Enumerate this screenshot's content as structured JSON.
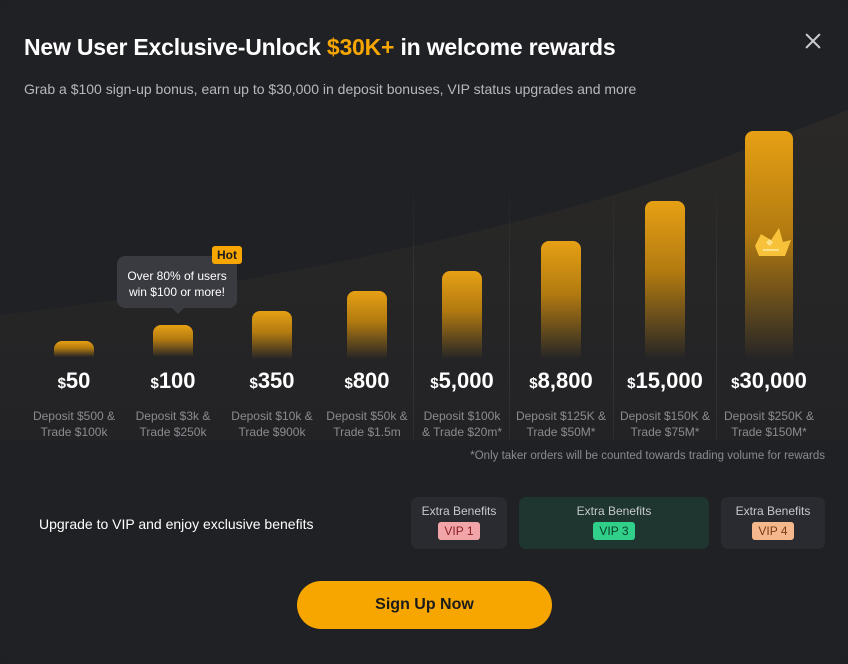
{
  "header": {
    "title_prefix": "New User Exclusive-Unlock ",
    "title_accent": "$30K+",
    "title_suffix": " in welcome rewards",
    "subtitle": "Grab a $100 sign-up bonus, earn up to $30,000 in deposit bonuses, VIP status upgrades and more",
    "close_icon": "close-icon"
  },
  "tiers": [
    {
      "currency": "$",
      "amount": "50",
      "requirement": "Deposit $500 &\nTrade $100k"
    },
    {
      "currency": "$",
      "amount": "100",
      "requirement": "Deposit $3k &\nTrade $250k"
    },
    {
      "currency": "$",
      "amount": "350",
      "requirement": "Deposit $10k &\nTrade $900k"
    },
    {
      "currency": "$",
      "amount": "800",
      "requirement": "Deposit $50k &\nTrade $1.5m"
    },
    {
      "currency": "$",
      "amount": "5,000",
      "requirement": "Deposit $100k\n& Trade $20m*"
    },
    {
      "currency": "$",
      "amount": "8,800",
      "requirement": "Deposit $125K &\nTrade $50M*"
    },
    {
      "currency": "$",
      "amount": "15,000",
      "requirement": "Deposit $150K &\nTrade $75M*"
    },
    {
      "currency": "$",
      "amount": "30,000",
      "requirement": "Deposit $250K &\nTrade $150M*"
    }
  ],
  "tooltip": {
    "text": "Over 80% of users win $100 or more!",
    "line1": "Over 80% of users",
    "line2": "win $100 or more!"
  },
  "hot_badge": "Hot",
  "footnote": "*Only taker orders will be counted towards trading volume for rewards",
  "vip": {
    "label": "Upgrade to VIP and enjoy exclusive benefits",
    "cards": [
      {
        "caption": "Extra Benefits",
        "badge": "VIP 1",
        "badge_color": "#f2a5a8",
        "badge_text_color": "#8a1f25"
      },
      {
        "caption": "Extra Benefits",
        "badge": "VIP 3",
        "badge_color": "#30d08a",
        "badge_text_color": "#0c4027"
      },
      {
        "caption": "Extra Benefits",
        "badge": "VIP 4",
        "badge_color": "#f5b88c",
        "badge_text_color": "#7a3d12"
      }
    ]
  },
  "cta": {
    "label": "Sign Up Now"
  },
  "colors": {
    "accent": "#f7a600",
    "background": "#202125"
  }
}
